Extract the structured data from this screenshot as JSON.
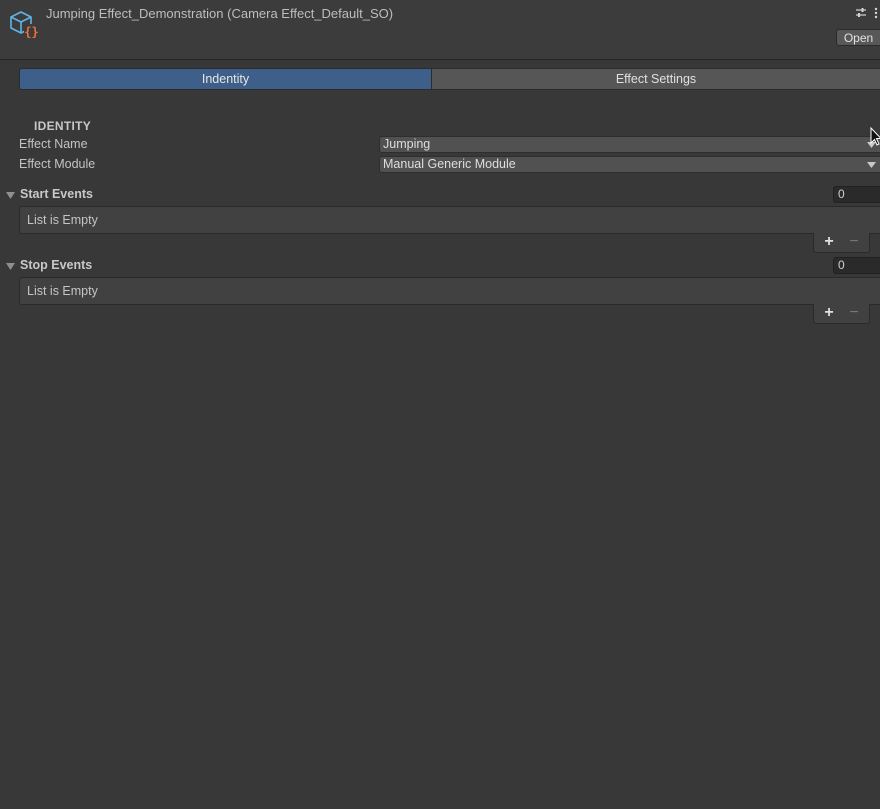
{
  "header": {
    "title": "Jumping Effect_Demonstration (Camera Effect_Default_SO)",
    "open_label": "Open",
    "asset_icon": "scriptable-object-icon",
    "settings_icon": "sliders-icon",
    "more_icon": "kebab-menu-icon"
  },
  "tabs": [
    {
      "label": "Indentity",
      "active": true
    },
    {
      "label": "Effect Settings",
      "active": false
    }
  ],
  "identity": {
    "section_label": "IDENTITY",
    "fields": [
      {
        "label": "Effect Name",
        "value": "Jumping"
      },
      {
        "label": "Effect Module",
        "value": "Manual Generic Module"
      }
    ]
  },
  "lists": [
    {
      "title": "Start Events",
      "count": "0",
      "empty_text": "List is Empty",
      "add_label": "+",
      "remove_label": "−"
    },
    {
      "title": "Stop Events",
      "count": "0",
      "empty_text": "List is Empty",
      "add_label": "+",
      "remove_label": "−"
    }
  ],
  "colors": {
    "background": "#383838",
    "header": "#3c3c3c",
    "active_tab": "#3e5f8a",
    "inactive_tab": "#565656",
    "field": "#515151",
    "asset_icon_blue": "#5fb4e6",
    "asset_icon_orange": "#f0703a"
  }
}
